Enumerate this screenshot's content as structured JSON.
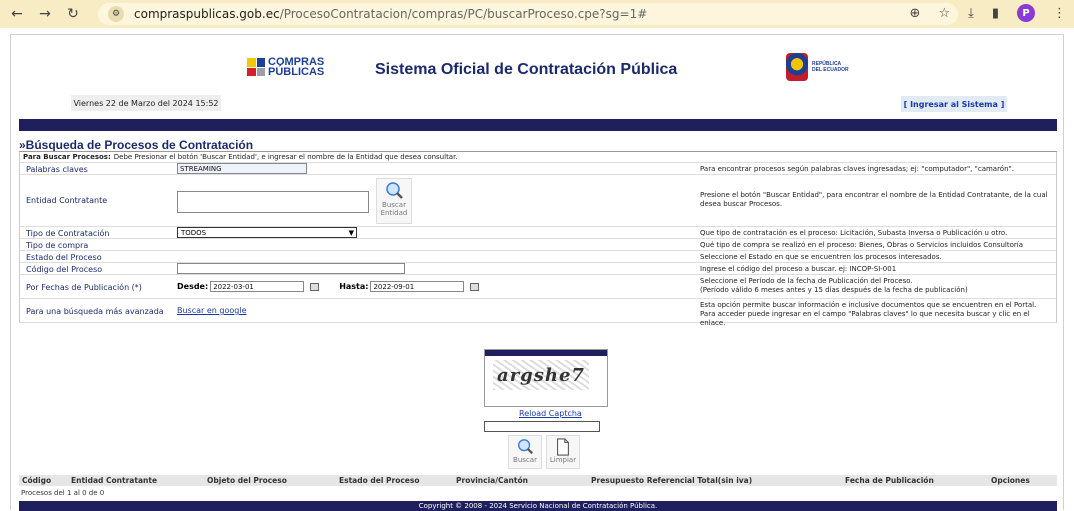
{
  "browser": {
    "url_host": "compraspublicas.gob.ec",
    "url_path": "/ProcesoContratacion/compras/PC/buscarProceso.cpe?sg=1#",
    "profile_initial": "P"
  },
  "header": {
    "logo_line1": "COMPRAS",
    "logo_line2": "PÚBLICAS",
    "title": "Sistema Oficial de Contratación Pública",
    "rep_line1": "REPÚBLICA",
    "rep_line2": "DEL ECUADOR",
    "date": "Viernes 22 de Marzo del 2024 15:52",
    "login": "[ Ingresar al Sistema ]"
  },
  "search": {
    "title": "»Búsqueda de Procesos de Contratación",
    "instr_bold": "Para Buscar Procesos:",
    "instr_text": "Debe Presionar el botón 'Buscar Entidad', e ingresar el nombre de la Entidad que desea consultar.",
    "keywords_label": "Palabras claves",
    "keywords_value": "STREAMING",
    "keywords_help": "Para encontrar procesos según palabras claves ingresadas; ej: \"computador\", \"camarón\".",
    "entity_label": "Entidad Contratante",
    "entity_btn_line1": "Buscar",
    "entity_btn_line2": "Entidad",
    "entity_help": "Presione el botón \"Buscar Entidad\", para encontrar el nombre de la Entidad Contratante, de la cual desea buscar Procesos.",
    "type_label": "Tipo de Contratación",
    "type_value": "TODOS",
    "type_help": "Que tipo de contratación es el proceso: Licitación, Subasta Inversa o Publicación u otro.",
    "purchase_label": "Tipo de compra",
    "purchase_help": "Qué tipo de compra se realizó en el proceso: Bienes, Obras o Servicios incluidos Consultoría",
    "state_label": "Estado del Proceso",
    "state_help": "Seleccione el Estado en que se encuentren los procesos interesados.",
    "code_label": "Código del Proceso",
    "code_help": "Ingrese el código del proceso a buscar. ej: INCOP-SI-001",
    "dates_label": "Por Fechas de Publicación (*)",
    "from_label": "Desde:",
    "from_value": "2022-03-01",
    "to_label": "Hasta:",
    "to_value": "2022-09-01",
    "dates_help_1": "Seleccione el Período de la fecha de Publicación del Proceso.",
    "dates_help_2": "(Período válido 6 meses antes y 15 días después de la fecha de publicación)",
    "advanced_label": "Para una búsqueda más avanzada",
    "advanced_link": "Buscar en google",
    "advanced_help": "Esta opción permite buscar información e inclusive documentos que se encuentren en el Portal. Para acceder puede ingresar en el campo \"Palabras claves\" lo que necesita buscar y clic en el enlace."
  },
  "captcha": {
    "text": "argshe7",
    "reload": "Reload Captcha",
    "search_btn": "Buscar",
    "clear_btn": "Limpiar"
  },
  "results": {
    "columns": [
      "Código",
      "Entidad Contratante",
      "Objeto del Proceso",
      "Estado del Proceso",
      "Provincia/Cantón",
      "Presupuesto Referencial Total(sin iva)",
      "Fecha de Publicación",
      "Opciones"
    ],
    "count": "Procesos del 1 al 0 de 0"
  },
  "footer": {
    "copyright": "Copyright © 2008 - 2024 Servicio Nacional de Contratación Pública."
  }
}
